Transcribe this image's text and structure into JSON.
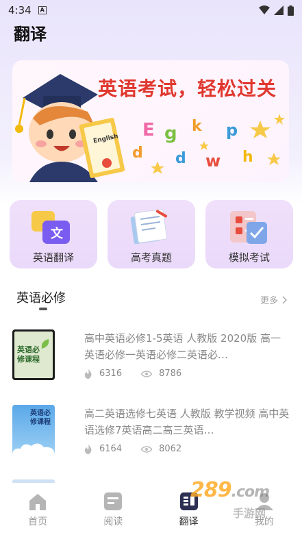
{
  "status_bar": {
    "time": "4:34",
    "notification_icon": "A"
  },
  "header": {
    "title": "翻译"
  },
  "banner": {
    "headline": "英语考试，轻松过关",
    "diploma_text": "English",
    "letters": [
      "E",
      "g",
      "k",
      "p",
      "d",
      "d",
      "w",
      "h"
    ]
  },
  "features": [
    {
      "label": "英语翻译",
      "icon": "translate-icon"
    },
    {
      "label": "高考真题",
      "icon": "exam-papers-icon"
    },
    {
      "label": "模拟考试",
      "icon": "mock-test-icon"
    }
  ],
  "section": {
    "title": "英语必修",
    "more": "更多"
  },
  "courses": [
    {
      "title": "高中英语必修1-5英语 人教版 2020版 高一英语必修一英语必修二英语必…",
      "likes": "6316",
      "views": "8786",
      "thumb_text": "英语必修课程"
    },
    {
      "title": "高二英语选修七英语 人教版 教学视频 高中英语选修7英语高二高三英语…",
      "likes": "6164",
      "views": "8062",
      "thumb_text": "英语必修课程"
    }
  ],
  "tabbar": {
    "tabs": [
      {
        "label": "首页",
        "icon": "home-icon",
        "active": false
      },
      {
        "label": "阅读",
        "icon": "reading-icon",
        "active": false
      },
      {
        "label": "翻译",
        "icon": "translate-tab-icon",
        "active": true
      },
      {
        "label": "我的",
        "icon": "profile-icon",
        "active": false
      }
    ]
  },
  "watermark": {
    "main": "289",
    "suffix": ".com",
    "sub": "手游网"
  },
  "colors": {
    "accent": "#2c2f52",
    "banner_text": "#e0382f",
    "feature_bg": "#ecdcfa"
  }
}
